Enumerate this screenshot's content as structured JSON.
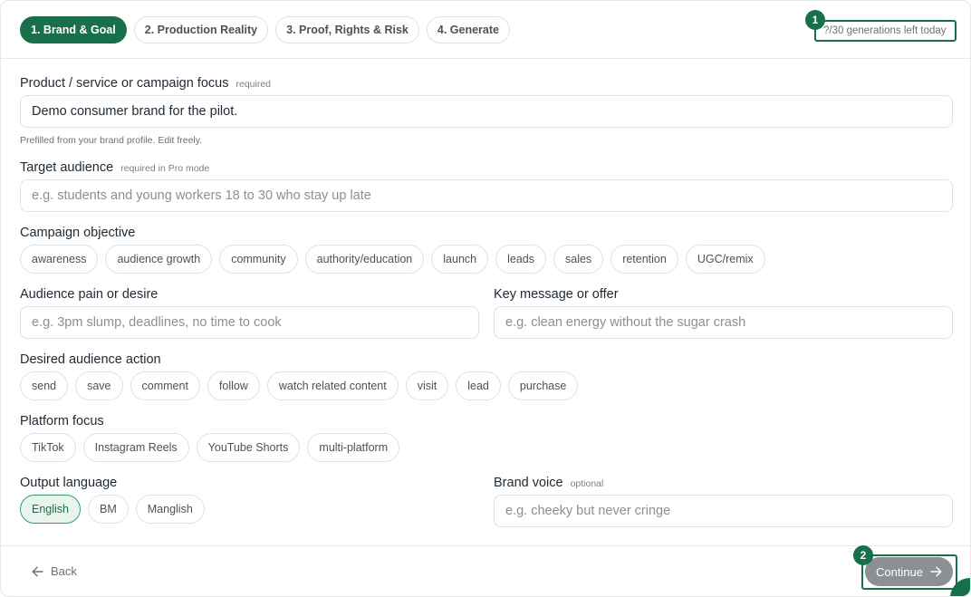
{
  "steps": [
    {
      "label": "1. Brand & Goal",
      "active": true
    },
    {
      "label": "2. Production Reality"
    },
    {
      "label": "3. Proof, Rights & Risk"
    },
    {
      "label": "4. Generate"
    }
  ],
  "quota": {
    "text": "?/30 generations left today"
  },
  "markers": [
    "1",
    "2"
  ],
  "form": {
    "product": {
      "label": "Product / service or campaign focus",
      "hint": "required",
      "value": "Demo consumer brand for the pilot.",
      "help": "Prefilled from your brand profile. Edit freely."
    },
    "audience": {
      "label": "Target audience",
      "hint": "required in Pro mode",
      "placeholder": "e.g. students and young workers 18 to 30 who stay up late"
    },
    "objective": {
      "label": "Campaign objective",
      "options": [
        "awareness",
        "audience growth",
        "community",
        "authority/education",
        "launch",
        "leads",
        "sales",
        "retention",
        "UGC/remix"
      ]
    },
    "pain": {
      "label": "Audience pain or desire",
      "placeholder": "e.g. 3pm slump, deadlines, no time to cook"
    },
    "message": {
      "label": "Key message or offer",
      "placeholder": "e.g. clean energy without the sugar crash"
    },
    "action": {
      "label": "Desired audience action",
      "options": [
        "send",
        "save",
        "comment",
        "follow",
        "watch related content",
        "visit",
        "lead",
        "purchase"
      ]
    },
    "platform": {
      "label": "Platform focus",
      "options": [
        "TikTok",
        "Instagram Reels",
        "YouTube Shorts",
        "multi-platform"
      ]
    },
    "language": {
      "label": "Output language",
      "options": [
        "English",
        "BM",
        "Manglish"
      ],
      "selected": "English"
    },
    "voice": {
      "label": "Brand voice",
      "hint": "optional",
      "placeholder": "e.g. cheeky but never cringe"
    }
  },
  "footer": {
    "back_label": "Back",
    "continue_label": "Continue"
  },
  "colors": {
    "accent": "#17704a",
    "accent_light": "#e7f5ee",
    "button_disabled": "#8c8f93",
    "border": "#dfe2e5"
  },
  "icons": {
    "back": "arrow-left-icon",
    "continue": "arrow-right-icon"
  }
}
